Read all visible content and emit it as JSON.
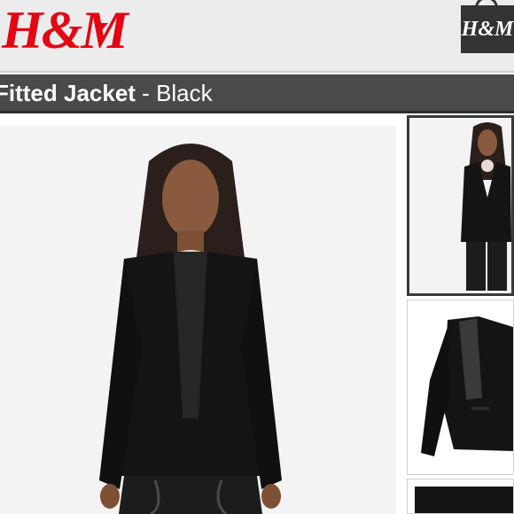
{
  "header": {
    "logo_text": "H&M",
    "brand_color": "#e30613",
    "menu_icon": "chevron-down-icon",
    "bag_label": "H&M",
    "bag_icon": "shopping-bag-icon"
  },
  "product": {
    "name": "Fitted Jacket",
    "separator": " - ",
    "color": "Black"
  },
  "gallery": {
    "thumbnails": [
      {
        "selected": true
      },
      {
        "selected": false
      },
      {
        "selected": false
      }
    ]
  }
}
